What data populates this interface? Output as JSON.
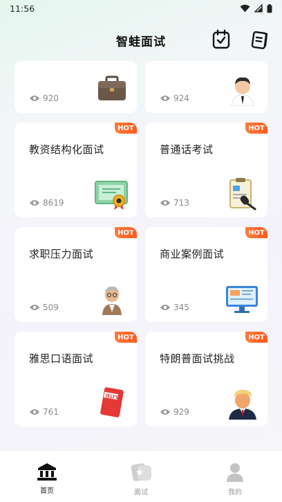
{
  "status_bar": {
    "time": "11:56"
  },
  "header": {
    "title": "智蛙面试"
  },
  "cards": [
    {
      "title": "",
      "views": "920",
      "hot": "",
      "icon": "briefcase-icon"
    },
    {
      "title": "",
      "views": "924",
      "hot": "",
      "icon": "businessman-avatar-icon"
    },
    {
      "title": "教资结构化面试",
      "views": "8619",
      "hot": "HOT",
      "icon": "certificate-icon"
    },
    {
      "title": "普通话考试",
      "views": "713",
      "hot": "HOT",
      "icon": "clipboard-microphone-icon"
    },
    {
      "title": "求职压力面试",
      "views": "509",
      "hot": "HOT",
      "icon": "elder-interviewer-icon"
    },
    {
      "title": "商业案例面试",
      "views": "345",
      "hot": "HOT",
      "icon": "monitor-icon"
    },
    {
      "title": "雅思口语面试",
      "views": "761",
      "hot": "HOT",
      "icon": "ielts-book-icon"
    },
    {
      "title": "特朗普面试挑战",
      "views": "929",
      "hot": "HOT",
      "icon": "trump-avatar-icon"
    }
  ],
  "tabbar": {
    "items": [
      {
        "label": "首页",
        "icon": "home-bank-icon",
        "active": true
      },
      {
        "label": "面试",
        "icon": "interview-cards-icon",
        "active": false
      },
      {
        "label": "我的",
        "icon": "profile-icon",
        "active": false
      }
    ]
  },
  "colors": {
    "hot_badge": "#ff6a2a",
    "accent": "#222222",
    "muted": "#888888"
  }
}
